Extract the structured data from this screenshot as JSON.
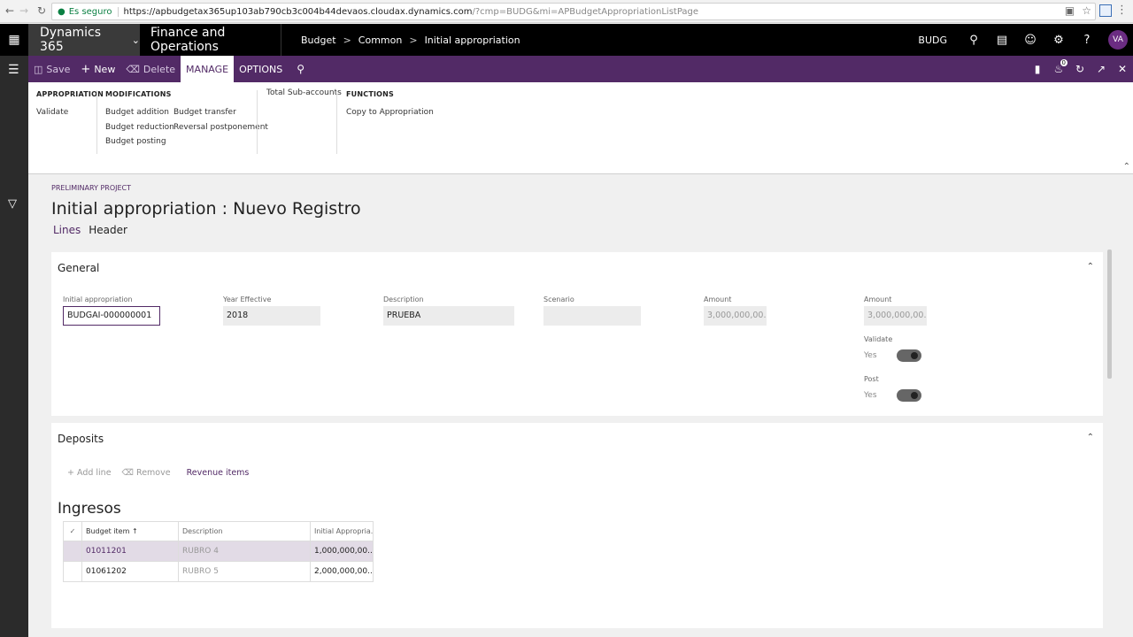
{
  "browser": {
    "secure_label": "Es seguro",
    "url_host": "https://apbudgetax365up103ab790cb3c004b44devaos.cloudax.dynamics.com",
    "url_path": "/?cmp=BUDG&mi=APBudgetAppropriationListPage"
  },
  "topbar": {
    "brand": "Dynamics 365",
    "app_name": "Finance and Operations",
    "breadcrumb": [
      "Budget",
      "Common",
      "Initial appropriation"
    ],
    "company": "BUDG",
    "avatar_initials": "VA"
  },
  "actionbar": {
    "save": "Save",
    "new": "New",
    "delete": "Delete",
    "tabs": [
      "MANAGE",
      "OPTIONS"
    ],
    "notification_count": "0"
  },
  "ribbon": {
    "appropriation": {
      "header": "APPROPRIATION",
      "items": [
        "Validate"
      ]
    },
    "modifications": {
      "header": "MODIFICATIONS",
      "col1": [
        "Budget addition",
        "Budget reduction",
        "Budget posting"
      ],
      "col2": [
        "Budget transfer",
        "Reversal postponement"
      ]
    },
    "subaccounts": {
      "items": [
        "Total Sub-accounts"
      ]
    },
    "functions": {
      "header": "FUNCTIONS",
      "items": [
        "Copy to Appropriation"
      ]
    }
  },
  "page": {
    "caption": "PRELIMINARY PROJECT",
    "title": "Initial appropriation : Nuevo Registro",
    "view_tabs": [
      "Lines",
      "Header"
    ]
  },
  "general": {
    "title": "General",
    "fields": {
      "initial_appropriation": {
        "label": "Initial appropriation",
        "value": "BUDGAI-000000001"
      },
      "year_effective": {
        "label": "Year Effective",
        "value": "2018"
      },
      "description": {
        "label": "Description",
        "value": "PRUEBA"
      },
      "scenario": {
        "label": "Scenario",
        "value": ""
      },
      "amount1": {
        "label": "Amount",
        "value": "3,000,000,00..."
      },
      "amount2": {
        "label": "Amount",
        "value": "3,000,000,00..."
      }
    },
    "validate": {
      "label": "Validate",
      "value": "Yes"
    },
    "post": {
      "label": "Post",
      "value": "Yes"
    }
  },
  "deposits": {
    "title": "Deposits",
    "add_line": "Add line",
    "remove": "Remove",
    "revenue_items": "Revenue items",
    "grid_title": "Ingresos",
    "columns": [
      "Budget item",
      "Description",
      "Initial Appropria..."
    ],
    "rows": [
      {
        "budget_item": "01011201",
        "description": "RUBRO 4",
        "amount": "1,000,000,00..."
      },
      {
        "budget_item": "01061202",
        "description": "RUBRO 5",
        "amount": "2,000,000,00..."
      }
    ]
  }
}
